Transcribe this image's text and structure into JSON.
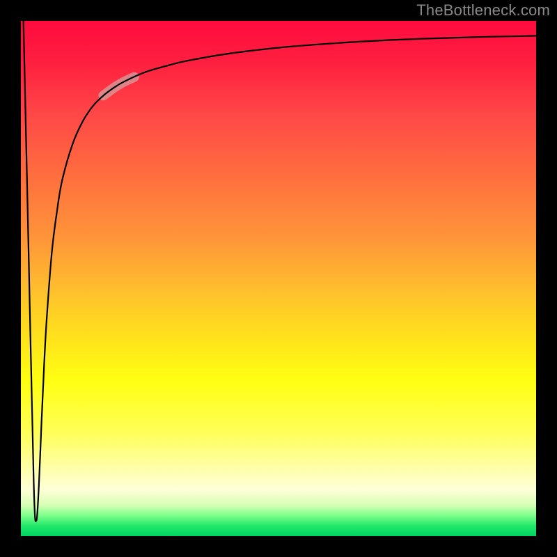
{
  "watermark": "TheBottleneck.com",
  "chart_data": {
    "type": "line",
    "title": "",
    "xlabel": "",
    "ylabel": "",
    "xlim": [
      0,
      100
    ],
    "ylim": [
      0,
      100
    ],
    "grid": false,
    "legend": false,
    "background_gradient": {
      "direction": "vertical",
      "stops": [
        {
          "pos": 0,
          "color": "#ff0b3f"
        },
        {
          "pos": 30,
          "color": "#ff6e3e"
        },
        {
          "pos": 62,
          "color": "#ffe41a"
        },
        {
          "pos": 91,
          "color": "#ffffd8"
        },
        {
          "pos": 100,
          "color": "#00d460"
        }
      ]
    },
    "series": [
      {
        "name": "bottleneck-curve",
        "x": [
          0.5,
          1.5,
          2.5,
          3.0,
          3.5,
          4.0,
          4.5,
          5,
          6,
          7,
          8,
          10,
          12,
          14,
          16,
          18,
          20,
          24,
          28,
          32,
          40,
          50,
          60,
          70,
          80,
          90,
          100
        ],
        "y": [
          100,
          55,
          10,
          3,
          10,
          22,
          33,
          42,
          55,
          63,
          69,
          76,
          80.5,
          83.5,
          85.5,
          87,
          88.2,
          90,
          91.2,
          92.2,
          93.6,
          94.8,
          95.6,
          96.2,
          96.6,
          96.9,
          97.1
        ]
      }
    ],
    "highlight_segment": {
      "x_start": 16,
      "x_end": 22
    }
  }
}
